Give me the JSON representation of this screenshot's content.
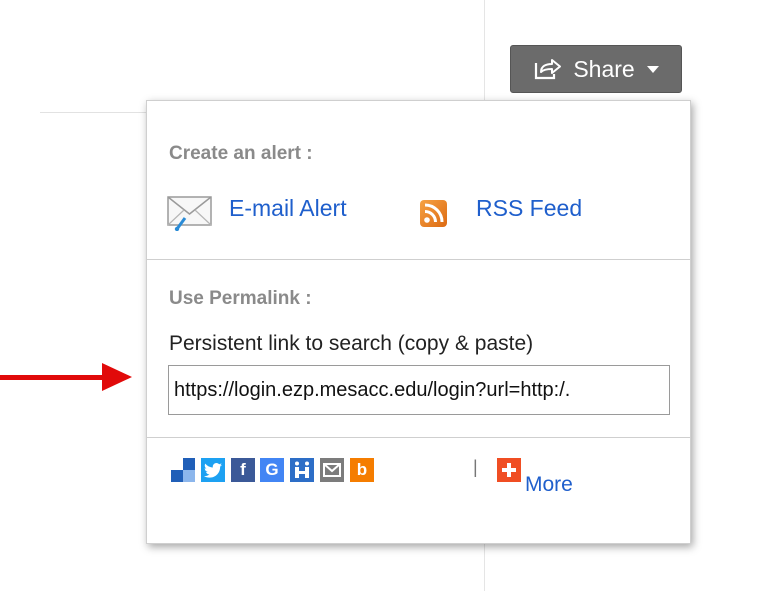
{
  "share_button": {
    "label": "Share",
    "icon": "share-icon"
  },
  "alert_section": {
    "title": "Create an alert :",
    "email_alert": {
      "label": "E-mail Alert",
      "icon": "envelope-icon"
    },
    "rss_feed": {
      "label": "RSS Feed",
      "icon": "rss-icon"
    }
  },
  "permalink_section": {
    "title": "Use Permalink :",
    "description": "Persistent link to search (copy & paste)",
    "url": "https://login.ezp.mesacc.edu/login?url=http:/."
  },
  "social": {
    "icons": [
      {
        "name": "delicious-icon",
        "glyph": ""
      },
      {
        "name": "twitter-icon",
        "glyph": ""
      },
      {
        "name": "facebook-icon",
        "glyph": "f"
      },
      {
        "name": "google-icon",
        "glyph": "G"
      },
      {
        "name": "mendeley-icon",
        "glyph": ""
      },
      {
        "name": "email-icon",
        "glyph": ""
      },
      {
        "name": "blogger-icon",
        "glyph": "b"
      }
    ],
    "more_label": "More"
  },
  "colors": {
    "share_button": "#6b6b6b",
    "link": "#1f5fcc",
    "arrow": "#e10a0a",
    "delicious": "#3274d1",
    "twitter": "#1da1f2",
    "facebook": "#3b5998",
    "google": "#4285f4",
    "mendeley": "#2d6ec7",
    "email": "#7c7c7c",
    "blogger": "#f57d00",
    "more": "#f04e23"
  }
}
